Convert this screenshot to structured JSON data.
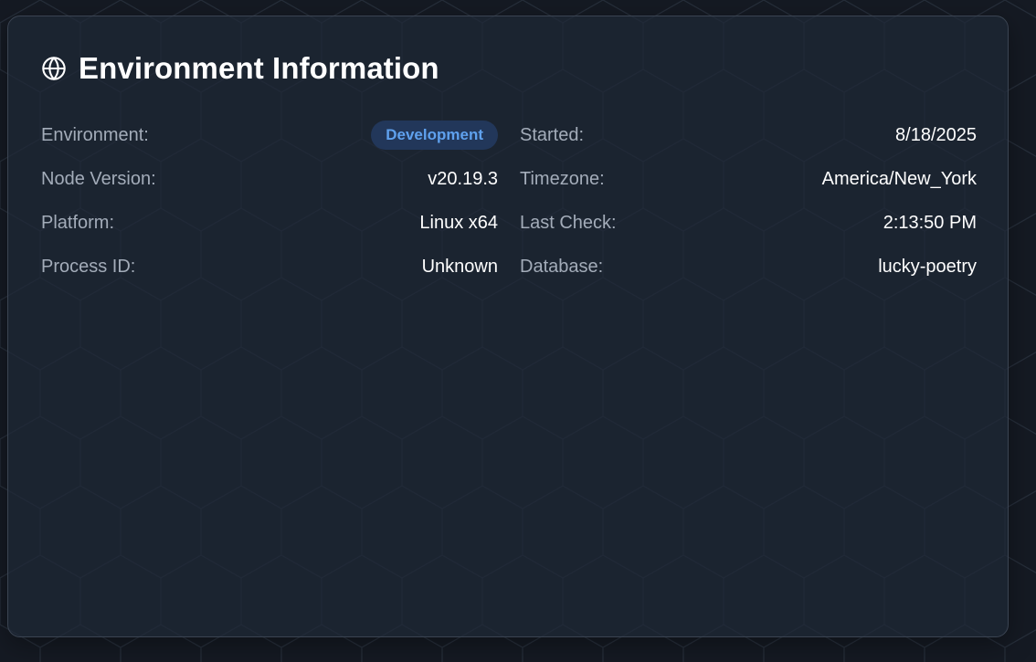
{
  "card": {
    "title": "Environment Information",
    "icon": "globe-icon"
  },
  "info_left": [
    {
      "label": "Environment:",
      "value": "Development",
      "style": "badge"
    },
    {
      "label": "Node Version:",
      "value": "v20.19.3"
    },
    {
      "label": "Platform:",
      "value": "Linux x64"
    },
    {
      "label": "Process ID:",
      "value": "Unknown"
    }
  ],
  "info_right": [
    {
      "label": "Started:",
      "value": "8/18/2025"
    },
    {
      "label": "Timezone:",
      "value": "America/New_York"
    },
    {
      "label": "Last Check:",
      "value": "2:13:50 PM"
    },
    {
      "label": "Database:",
      "value": "lucky-poetry"
    }
  ],
  "colors": {
    "background": "#151a23",
    "card": "#1e2836",
    "label": "#a3acb9",
    "value": "#ffffff",
    "badge_bg": "#22375a",
    "badge_text": "#5fa1ee"
  }
}
